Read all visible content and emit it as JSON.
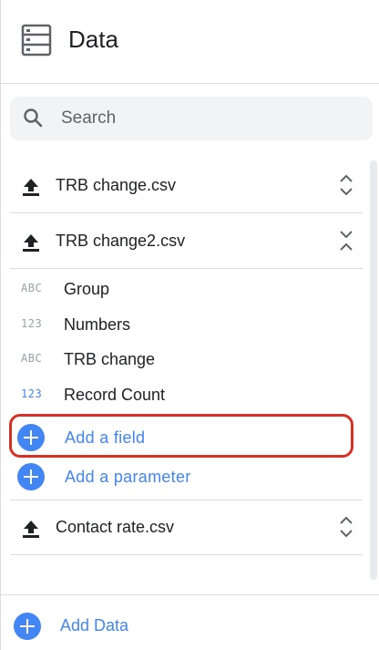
{
  "header": {
    "title": "Data",
    "icon": "database-icon"
  },
  "search": {
    "placeholder": "Search"
  },
  "datasets": [
    {
      "label": "TRB change.csv",
      "expanded": false
    },
    {
      "label": "TRB change2.csv",
      "expanded": true
    },
    {
      "label": "Contact rate.csv",
      "expanded": false
    }
  ],
  "fields": [
    {
      "type": "ABC",
      "name": "Group"
    },
    {
      "type": "123",
      "name": "Numbers"
    },
    {
      "type": "ABC",
      "name": "TRB change"
    },
    {
      "type": "123",
      "name": "Record Count"
    }
  ],
  "actions": {
    "add_field": "Add a field",
    "add_parameter": "Add a parameter"
  },
  "footer": {
    "add_data": "Add Data"
  },
  "colors": {
    "accent": "#4285f4",
    "highlight": "#d93025"
  }
}
